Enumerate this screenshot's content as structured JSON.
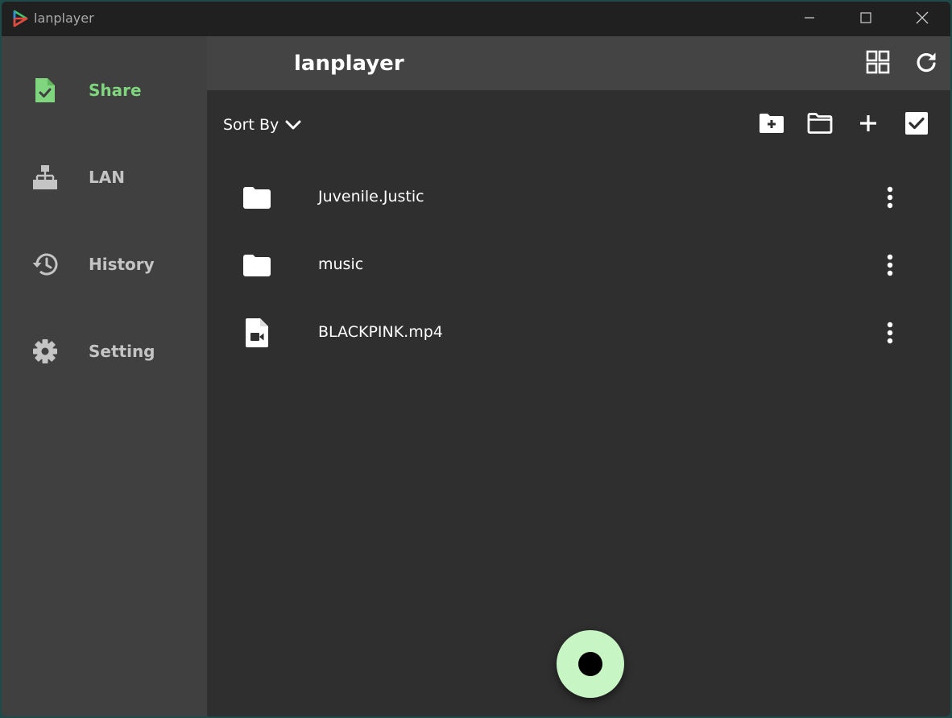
{
  "window": {
    "title": "lanplayer",
    "controls": [
      "minimize-icon",
      "maximize-icon",
      "close-icon"
    ]
  },
  "sidebar": {
    "items": [
      {
        "label": "Share",
        "icon": "file-check-icon",
        "active": true
      },
      {
        "label": "LAN",
        "icon": "sitemap-icon",
        "active": false
      },
      {
        "label": "History",
        "icon": "history-icon",
        "active": false
      },
      {
        "label": "Setting",
        "icon": "gear-icon",
        "active": false
      }
    ]
  },
  "header": {
    "title": "lanplayer",
    "actions": [
      "grid-view-icon",
      "refresh-icon"
    ]
  },
  "toolbar": {
    "sort_label": "Sort By",
    "actions": [
      "new-folder-icon",
      "folder-open-icon",
      "add-icon",
      "select-all-checkbox-icon"
    ]
  },
  "files": [
    {
      "name": "Juvenile.Justic",
      "type": "folder",
      "icon": "folder-icon"
    },
    {
      "name": "music",
      "type": "folder",
      "icon": "folder-icon"
    },
    {
      "name": "BLACKPINK.mp4",
      "type": "video",
      "icon": "video-file-icon"
    }
  ],
  "fab": {
    "icon": "record-icon"
  },
  "colors": {
    "accent": "#7fd67f",
    "fab_background": "#c8f5c4",
    "sidebar_background": "#404040",
    "header_background": "#444444",
    "content_background": "#2f2f2f",
    "titlebar_background": "#202020"
  }
}
